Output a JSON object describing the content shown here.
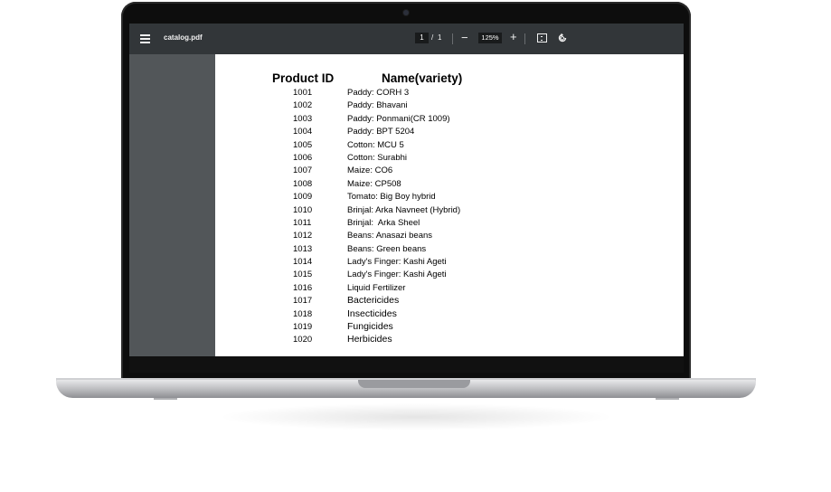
{
  "viewer": {
    "filename": "catalog.pdf",
    "current_page": "1",
    "page_separator": "/",
    "total_pages": "1",
    "zoom_out_symbol": "−",
    "zoom_level": "125%",
    "zoom_in_symbol": "+",
    "icons": [
      "menu-icon",
      "fit-to-page-icon",
      "rotate-icon"
    ]
  },
  "document": {
    "column_headers": [
      "Product ID",
      "Name(variety)"
    ],
    "rows": [
      {
        "id": "1001",
        "name": "Paddy: CORH 3"
      },
      {
        "id": "1002",
        "name": "Paddy: Bhavani"
      },
      {
        "id": "1003",
        "name": "Paddy: Ponmani(CR 1009)"
      },
      {
        "id": "1004",
        "name": "Paddy: BPT 5204"
      },
      {
        "id": "1005",
        "name": "Cotton: MCU 5"
      },
      {
        "id": "1006",
        "name": "Cotton: Surabhi"
      },
      {
        "id": "1007",
        "name": "Maize: CO6"
      },
      {
        "id": "1008",
        "name": "Maize: CP508"
      },
      {
        "id": "1009",
        "name": "Tomato: Big Boy hybrid"
      },
      {
        "id": "1010",
        "name": "Brinjal: Arka Navneet (Hybrid)"
      },
      {
        "id": "1011",
        "name": "Brinjal:  Arka Sheel"
      },
      {
        "id": "1012",
        "name": "Beans: Anasazi beans"
      },
      {
        "id": "1013",
        "name": "Beans: Green beans"
      },
      {
        "id": "1014",
        "name": "Lady's Finger: Kashi Ageti"
      },
      {
        "id": "1015",
        "name": "Lady's Finger: Kashi Ageti"
      },
      {
        "id": "1016",
        "name": "Liquid Fertilizer"
      },
      {
        "id": "1017",
        "name": "Bactericides"
      },
      {
        "id": "1018",
        "name": "Insecticides"
      },
      {
        "id": "1019",
        "name": "Fungicides"
      },
      {
        "id": "1020",
        "name": "Herbicides"
      }
    ]
  }
}
